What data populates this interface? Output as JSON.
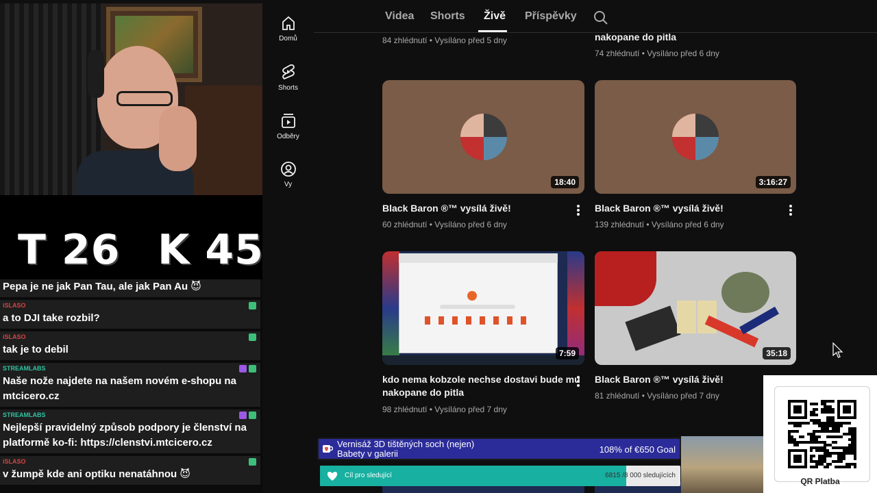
{
  "overlay": {
    "score_t": "T 26",
    "score_k": "K 45"
  },
  "chat": {
    "messages": [
      {
        "user": "",
        "text": "Pepa je ne jak Pan Tau, ale jak Pan Au 😈"
      },
      {
        "user": "iSLASO",
        "text": "a to DJI take rozbil?"
      },
      {
        "user": "iSLASO",
        "text": "tak je to debil"
      },
      {
        "user": "STREAMLABS",
        "text1": "Naše nože najdete na našem novém e-shopu na",
        "text2": "mtcicero.cz"
      },
      {
        "user": "STREAMLABS",
        "text1": "Nejlepší pravidelný způsob podpory je členství na",
        "text2": "platformě ko-fi: https://clenstvi.mtcicero.cz"
      },
      {
        "user": "iSLASO",
        "text": "v žumpě kde ani optiku nenatáhnou 😈"
      }
    ]
  },
  "sidebar": {
    "items": [
      {
        "label": "Domů",
        "icon": "home-icon"
      },
      {
        "label": "Shorts",
        "icon": "shorts-icon"
      },
      {
        "label": "Odběry",
        "icon": "subscriptions-icon"
      },
      {
        "label": "Vy",
        "icon": "account-icon"
      }
    ]
  },
  "tabs": [
    {
      "label": "Videa"
    },
    {
      "label": "Shorts"
    },
    {
      "label": "Živě",
      "active": true
    },
    {
      "label": "Příspěvky"
    }
  ],
  "videos": {
    "top_left_meta": "84 zhlédnutí • Vysíláno před 5 dny",
    "top_right_title": "nakopane do pitla",
    "top_right_meta": "74 zhlédnutí • Vysíláno před 6 dny",
    "v1": {
      "duration": "18:40",
      "title": "Black Baron ®™ vysílá živě!",
      "meta": "60 zhlédnutí • Vysíláno před 6 dny"
    },
    "v2": {
      "duration": "3:16:27",
      "title": "Black Baron ®™ vysílá živě!",
      "meta": "139 zhlédnutí • Vysíláno před 6 dny"
    },
    "v3": {
      "duration": "7:59",
      "title1": "kdo nema kobzole nechse dostavi bude mu",
      "title2": "nakopane do pitla",
      "meta": "98 zhlédnutí • Vysíláno před 7 dny"
    },
    "v4": {
      "duration": "35:18",
      "title": "Black Baron ®™ vysílá živě!",
      "meta": "81 zhlédnutí • Vysíláno před 7 dny"
    }
  },
  "goal": {
    "text1": "Vernisáž 3D tištěných soch (nejen)",
    "text2": "Babety v galerii",
    "progress_text": "108% of €650 Goal"
  },
  "followers": {
    "label": "Cíl pro sledující",
    "count": "6815 /8 000 sledujících",
    "progress": 0.85
  },
  "qr": {
    "label": "QR Platba"
  },
  "colors": {
    "islaso": "#d64545",
    "streamlabs": "#31c3a2",
    "goal_bg": "#2b2b9a",
    "followers_fill": "#18b0a0"
  }
}
